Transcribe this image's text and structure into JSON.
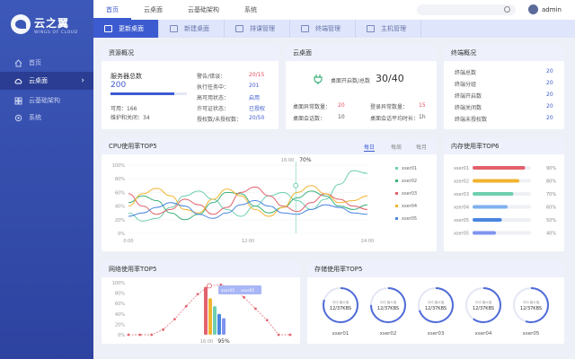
{
  "brand": {
    "name": "云之翼",
    "sub": "WINGS OF CLOUD"
  },
  "sidebar": {
    "items": [
      {
        "label": "首页"
      },
      {
        "label": "云桌面"
      },
      {
        "label": "云基础架构"
      },
      {
        "label": "系统"
      }
    ]
  },
  "topbar": {
    "tabs": [
      "首页",
      "云桌面",
      "云基础架构",
      "系统"
    ],
    "user": "admin"
  },
  "subnav": {
    "tabs": [
      "更新桌面",
      "新建桌面",
      "排课管理",
      "终端管理",
      "主机管理"
    ]
  },
  "resource": {
    "title": "资源概况",
    "total_label": "服务器总数",
    "total": "200",
    "available": "可用：166",
    "maintenance": "维护和关闭：34",
    "progress": 0.83,
    "rows": [
      [
        "警告/错误：",
        "20/15"
      ],
      [
        "执行任务中：",
        "201"
      ],
      [
        "高可用状态：",
        "启用"
      ],
      [
        "许可证状态：",
        "已授权"
      ],
      [
        "授权数/未授权数：",
        "20/50"
      ]
    ]
  },
  "desktop": {
    "title": "云桌面",
    "online_label": "桌面开启数/总数",
    "online": "30/40",
    "stats": [
      [
        "桌面异常数量：",
        "20",
        "登录异常数量：",
        "15"
      ],
      [
        "桌面会话数：",
        "10",
        "桌面会话平均时长：",
        "1h"
      ]
    ]
  },
  "terminal": {
    "title": "终端概况",
    "rows": [
      [
        "终端总数",
        "20"
      ],
      [
        "终端分组",
        "20"
      ],
      [
        "终端开启数",
        "20"
      ],
      [
        "终端关闭数",
        "20"
      ],
      [
        "终端未授权数",
        "20"
      ]
    ]
  },
  "cpu": {
    "title": "CPU使用率TOP5",
    "tabs": [
      "每日",
      "每周",
      "每月"
    ],
    "tooltip": {
      "time": "16:00",
      "value": "70%"
    }
  },
  "memory": {
    "title": "内存使用率TOP6"
  },
  "network": {
    "title": "网络使用率TOP5",
    "tooltip": {
      "time": "16:00",
      "value": "95%"
    },
    "label1": "xser01",
    "label2": "xser01"
  },
  "storage": {
    "title": "存储使用率TOP5",
    "inner_label": "平均 最大值",
    "inner_value": "12/37KBS"
  },
  "colors": {
    "primary": "#3d5bd0",
    "red": "#e2616b",
    "yellow": "#f2b330",
    "green": "#6fcfb0",
    "blue": "#4a86e0",
    "lightblue": "#7fb1f0"
  },
  "chart_data": [
    {
      "type": "line",
      "title": "CPU使用率TOP5",
      "x": [
        "0:00",
        "12:00",
        "24:00"
      ],
      "ylim": [
        0,
        100
      ],
      "yticks": [
        "0%",
        "20%",
        "40%",
        "60%",
        "80%",
        "100%"
      ],
      "series": [
        {
          "name": "xser01",
          "color": "#6fcfb0",
          "values": [
            30,
            18,
            22,
            38,
            55,
            62,
            50,
            35,
            25,
            40,
            55,
            60,
            48,
            35,
            50,
            72,
            92,
            88
          ]
        },
        {
          "name": "xser02",
          "color": "#3bb07a",
          "values": [
            45,
            55,
            48,
            30,
            20,
            28,
            45,
            60,
            58,
            40,
            30,
            38,
            52,
            62,
            55,
            40,
            35,
            42
          ]
        },
        {
          "name": "xser03",
          "color": "#e2616b",
          "values": [
            58,
            40,
            28,
            35,
            50,
            42,
            28,
            38,
            60,
            68,
            55,
            40,
            32,
            45,
            58,
            50,
            40,
            35
          ]
        },
        {
          "name": "xser04",
          "color": "#f2b330",
          "values": [
            40,
            58,
            66,
            55,
            35,
            30,
            50,
            65,
            55,
            35,
            25,
            38,
            60,
            70,
            58,
            45,
            48,
            55
          ]
        },
        {
          "name": "xser05",
          "color": "#4a86e0",
          "values": [
            25,
            30,
            38,
            45,
            40,
            28,
            22,
            30,
            42,
            48,
            40,
            30,
            28,
            35,
            42,
            38,
            30,
            28
          ]
        }
      ]
    },
    {
      "type": "bar",
      "title": "内存使用率TOP6",
      "categories": [
        "xser01",
        "xser02",
        "xser03",
        "xser04",
        "xser05",
        "xser05"
      ],
      "values": [
        90,
        80,
        70,
        60,
        50,
        40
      ],
      "labels": [
        "90%",
        "80%",
        "70%",
        "60%",
        "50%",
        "40%"
      ],
      "colors": [
        "#e2616b",
        "#f2b330",
        "#6fcfb0",
        "#7fb1f0",
        "#4a86e0",
        "#7f93f0"
      ]
    },
    {
      "type": "bar",
      "title": "网络使用率TOP5",
      "ylim": [
        0,
        100
      ],
      "yticks": [
        "0%",
        "20%",
        "40%",
        "60%",
        "80%",
        "100%"
      ],
      "line": [
        0,
        0,
        0,
        10,
        30,
        55,
        78,
        94,
        96,
        90,
        72,
        50,
        28,
        0,
        0
      ],
      "bars": [
        {
          "value": 92,
          "color": "#e2616b"
        },
        {
          "value": 70,
          "color": "#f2b330"
        },
        {
          "value": 55,
          "color": "#6fcfb0"
        },
        {
          "value": 40,
          "color": "#4a86e0"
        },
        {
          "value": 32,
          "color": "#7f93f0"
        }
      ]
    },
    {
      "type": "pie",
      "title": "存储使用率TOP5",
      "items": [
        {
          "name": "xser01",
          "value": 80
        },
        {
          "name": "xser02",
          "value": 75
        },
        {
          "name": "xser03",
          "value": 70
        },
        {
          "name": "xser04",
          "value": 60
        },
        {
          "name": "xser05",
          "value": 55
        }
      ]
    }
  ]
}
